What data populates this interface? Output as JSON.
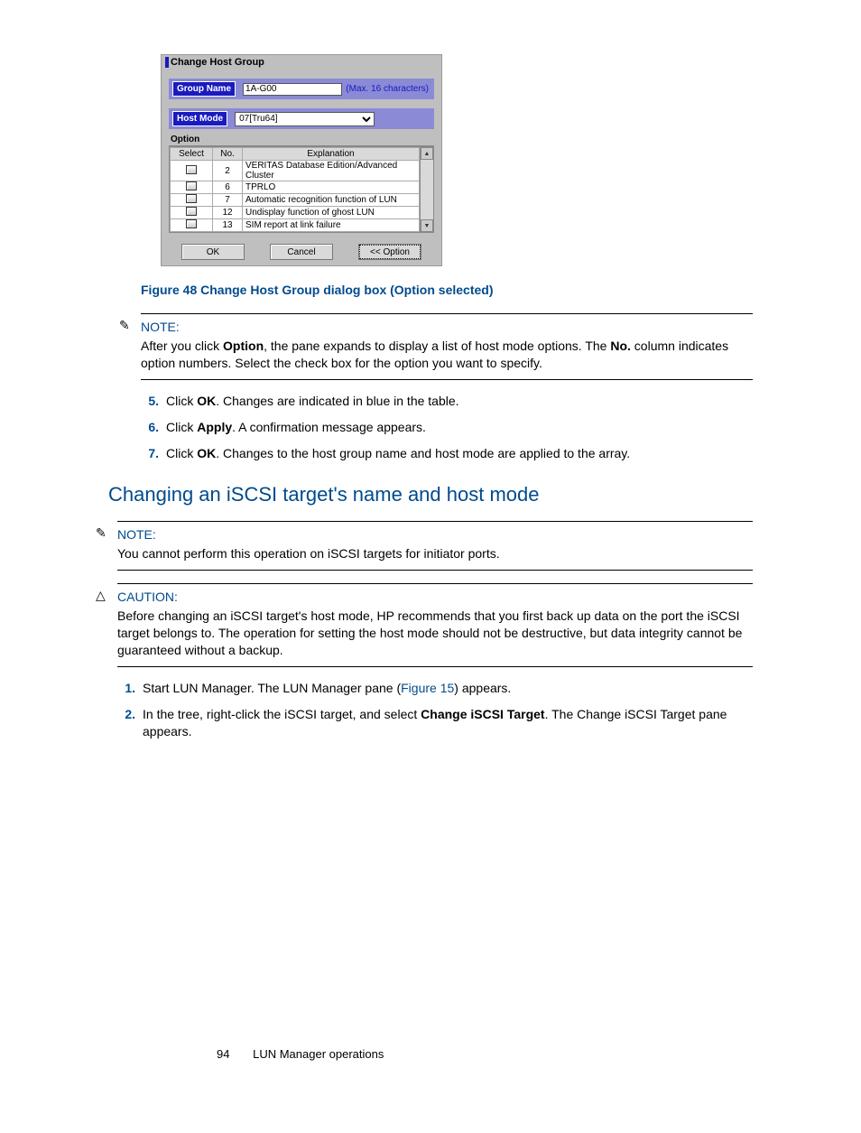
{
  "dialog": {
    "title": "Change Host Group",
    "group_name_label": "Group Name",
    "group_name_value": "1A-G00",
    "max_text": "(Max. 16 characters)",
    "host_mode_label": "Host Mode",
    "host_mode_value": "07[Tru64]",
    "option_label": "Option",
    "headers": {
      "select": "Select",
      "no": "No.",
      "explanation": "Explanation"
    },
    "rows": [
      {
        "no": "2",
        "exp": "VERITAS Database Edition/Advanced Cluster"
      },
      {
        "no": "6",
        "exp": "TPRLO"
      },
      {
        "no": "7",
        "exp": "Automatic recognition function of LUN"
      },
      {
        "no": "12",
        "exp": "Undisplay function of ghost LUN"
      },
      {
        "no": "13",
        "exp": "SIM report at link failure"
      }
    ],
    "buttons": {
      "ok": "OK",
      "cancel": "Cancel",
      "option": "<< Option"
    }
  },
  "fig_caption": "Figure 48 Change Host Group dialog box (Option selected)",
  "note1": {
    "head": "NOTE:",
    "body_1": "After you click ",
    "body_b1": "Option",
    "body_2": ", the pane expands to display a list of host mode options. The ",
    "body_b2": "No.",
    "body_3": " column indicates option numbers. Select the check box for the option you want to specify."
  },
  "steps_a": {
    "s5_a": "Click ",
    "s5_b": "OK",
    "s5_c": ". Changes are indicated in blue in the table.",
    "s6_a": "Click ",
    "s6_b": "Apply",
    "s6_c": ". A confirmation message appears.",
    "s7_a": "Click ",
    "s7_b": "OK",
    "s7_c": ". Changes to the host group name and host mode are applied to the array."
  },
  "section_head": "Changing an iSCSI target's name and host mode",
  "note2": {
    "head": "NOTE:",
    "body": "You cannot perform this operation on iSCSI targets for initiator ports."
  },
  "caution": {
    "head": "CAUTION:",
    "body": "Before changing an iSCSI target's host mode, HP recommends that you first back up data on the port the iSCSI target belongs to. The operation for setting the host mode should not be destructive, but data integrity cannot be guaranteed without a backup."
  },
  "steps_b": {
    "s1_a": "Start LUN Manager. The LUN Manager pane (",
    "s1_link": "Figure 15",
    "s1_b": ") appears.",
    "s2_a": "In the tree, right-click the iSCSI target, and select ",
    "s2_b": "Change iSCSI Target",
    "s2_c": ". The Change iSCSI Target pane appears."
  },
  "footer": {
    "page": "94",
    "title": "LUN Manager operations"
  }
}
